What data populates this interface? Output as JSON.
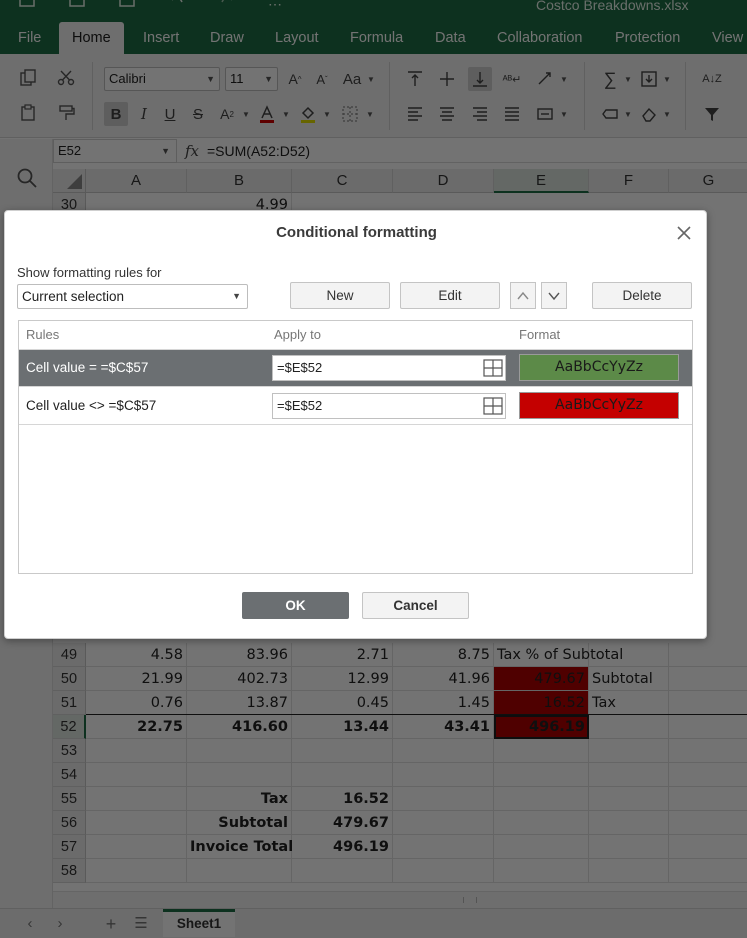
{
  "window": {
    "title": "Costco Breakdowns.xlsx"
  },
  "menu": {
    "items": [
      "File",
      "Home",
      "Insert",
      "Draw",
      "Layout",
      "Formula",
      "Data",
      "Collaboration",
      "Protection",
      "View"
    ],
    "active": "Home"
  },
  "ribbon": {
    "font_name": "Calibri",
    "font_size": "11",
    "change_case_label": "Aa",
    "underline_color": "#d00000",
    "highlight_color": "#e5e000",
    "icons": [
      "copy-icon",
      "cut-icon",
      "paste-icon",
      "format-painter-icon",
      "increase-font-icon",
      "decrease-font-icon",
      "change-case-icon",
      "bold-icon",
      "italic-icon",
      "underline-icon",
      "strikethrough-icon",
      "subscript-icon",
      "font-color-icon",
      "fill-color-icon",
      "borders-icon",
      "align-top-icon",
      "align-middle-icon",
      "align-bottom-icon",
      "wrap-text-icon",
      "orientation-icon",
      "align-left-icon",
      "align-center-icon",
      "align-right-icon",
      "justify-icon",
      "merge-icon",
      "sum-icon",
      "fill-icon",
      "sort-icon",
      "filter-icon",
      "number-format-icon",
      "clear-icon"
    ]
  },
  "formula_bar": {
    "cell_ref": "E52",
    "fx_label": "fx",
    "formula": "=SUM(A52:D52)"
  },
  "grid": {
    "columns": [
      "A",
      "B",
      "C",
      "D",
      "E",
      "F",
      "G"
    ],
    "selected_column": "E",
    "row30": {
      "num": "30",
      "B": "4.99"
    },
    "rows": [
      {
        "num": "49",
        "A": "4.58",
        "B": "83.96",
        "C": "2.71",
        "D": "8.75",
        "E": "Tax % of Subtotal",
        "F": ""
      },
      {
        "num": "50",
        "A": "21.99",
        "B": "402.73",
        "C": "12.99",
        "D": "41.96",
        "E": "479.67",
        "F": "Subtotal"
      },
      {
        "num": "51",
        "A": "0.76",
        "B": "13.87",
        "C": "0.45",
        "D": "1.45",
        "E": "16.52",
        "F": "Tax"
      },
      {
        "num": "52",
        "A": "22.75",
        "B": "416.60",
        "C": "13.44",
        "D": "43.41",
        "E": "496.19",
        "F": ""
      },
      {
        "num": "53",
        "A": "",
        "B": "",
        "C": "",
        "D": "",
        "E": "",
        "F": ""
      },
      {
        "num": "54",
        "A": "",
        "B": "",
        "C": "",
        "D": "",
        "E": "",
        "F": ""
      },
      {
        "num": "55",
        "A": "",
        "B": "Tax",
        "C": "16.52",
        "D": "",
        "E": "",
        "F": ""
      },
      {
        "num": "56",
        "A": "",
        "B": "Subtotal",
        "C": "479.67",
        "D": "",
        "E": "",
        "F": ""
      },
      {
        "num": "57",
        "A": "",
        "B": "Invoice Total",
        "C": "496.19",
        "D": "",
        "E": "",
        "F": ""
      },
      {
        "num": "58",
        "A": "",
        "B": "",
        "C": "",
        "D": "",
        "E": "",
        "F": ""
      }
    ]
  },
  "sheets": {
    "active": "Sheet1"
  },
  "dialog": {
    "title": "Conditional formatting",
    "show_rules_label": "Show formatting rules for",
    "show_rules_value": "Current selection",
    "new_label": "New",
    "edit_label": "Edit",
    "delete_label": "Delete",
    "headers": {
      "rules": "Rules",
      "apply_to": "Apply to",
      "format": "Format"
    },
    "rules": [
      {
        "condition": "Cell value = =$C$57",
        "apply_to": "=$E$52",
        "preview": "AaBbCcYyZz",
        "preview_color": "#5c8a48",
        "selected": true
      },
      {
        "condition": "Cell value <> =$C$57",
        "apply_to": "=$E$52",
        "preview": "AaBbCcYyZz",
        "preview_color": "#c40000",
        "selected": false
      }
    ],
    "ok_label": "OK",
    "cancel_label": "Cancel"
  }
}
